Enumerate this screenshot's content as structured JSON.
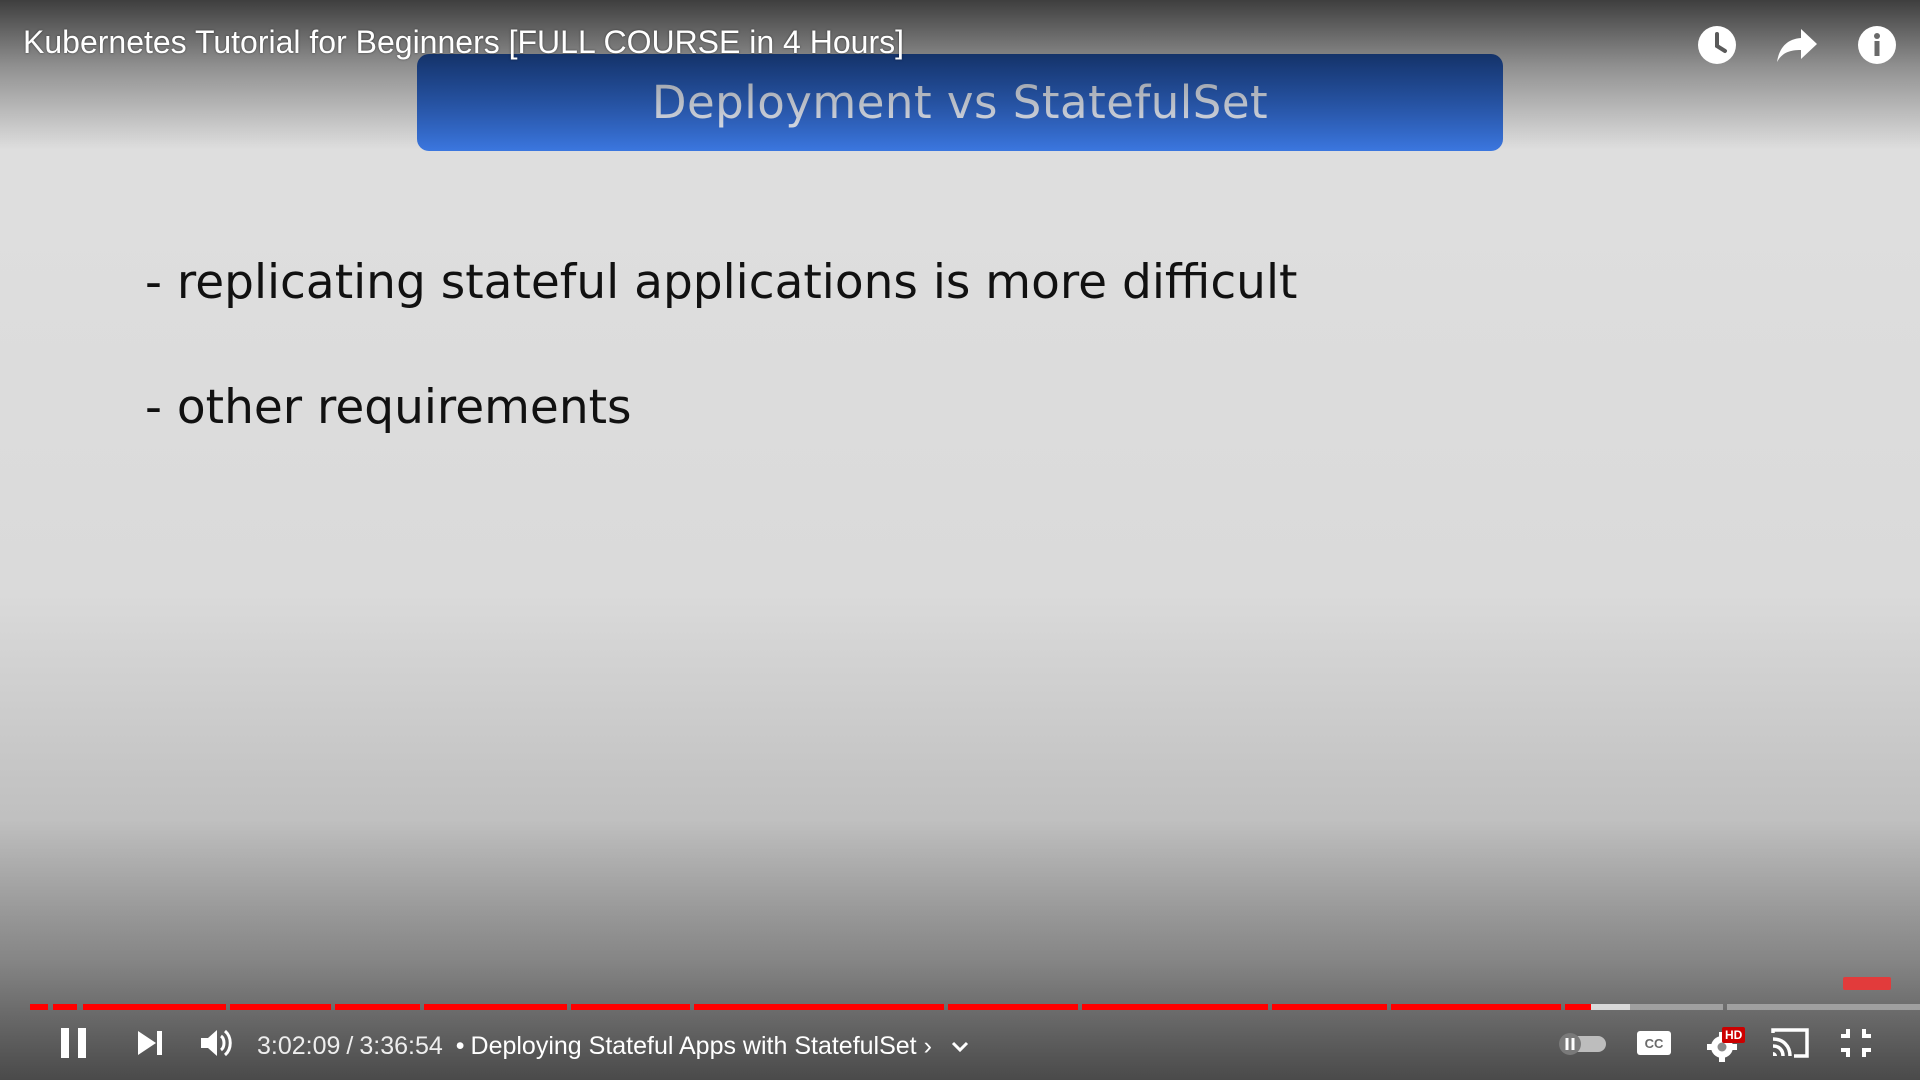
{
  "slide": {
    "title": "Deployment vs StatefulSet",
    "bullets": [
      "- replicating stateful applications is more difficult",
      "- other requirements"
    ]
  },
  "player": {
    "video_title": "Kubernetes Tutorial for Beginners [FULL COURSE in 4 Hours]",
    "current_time": "3:02:09",
    "duration": "3:36:54",
    "time_separator": "/",
    "chapter_bullet": "•",
    "chapter_title": "Deploying Stateful Apps with StatefulSet",
    "chapter_arrow": "›",
    "progress_fraction": 0.839,
    "buffer_fraction": 0.86,
    "hd_badge": "HD",
    "cc_label": "CC",
    "colors": {
      "progress": "#ff0000",
      "hd_badge": "#cc0000"
    },
    "top_icons": [
      "watch-later-icon",
      "share-icon",
      "info-icon"
    ],
    "bottom_icons": [
      "pause-icon",
      "next-icon",
      "volume-icon",
      "chevron-down-icon",
      "autoplay-toggle-icon",
      "captions-icon",
      "settings-icon",
      "cast-icon",
      "exit-fullscreen-icon"
    ]
  }
}
